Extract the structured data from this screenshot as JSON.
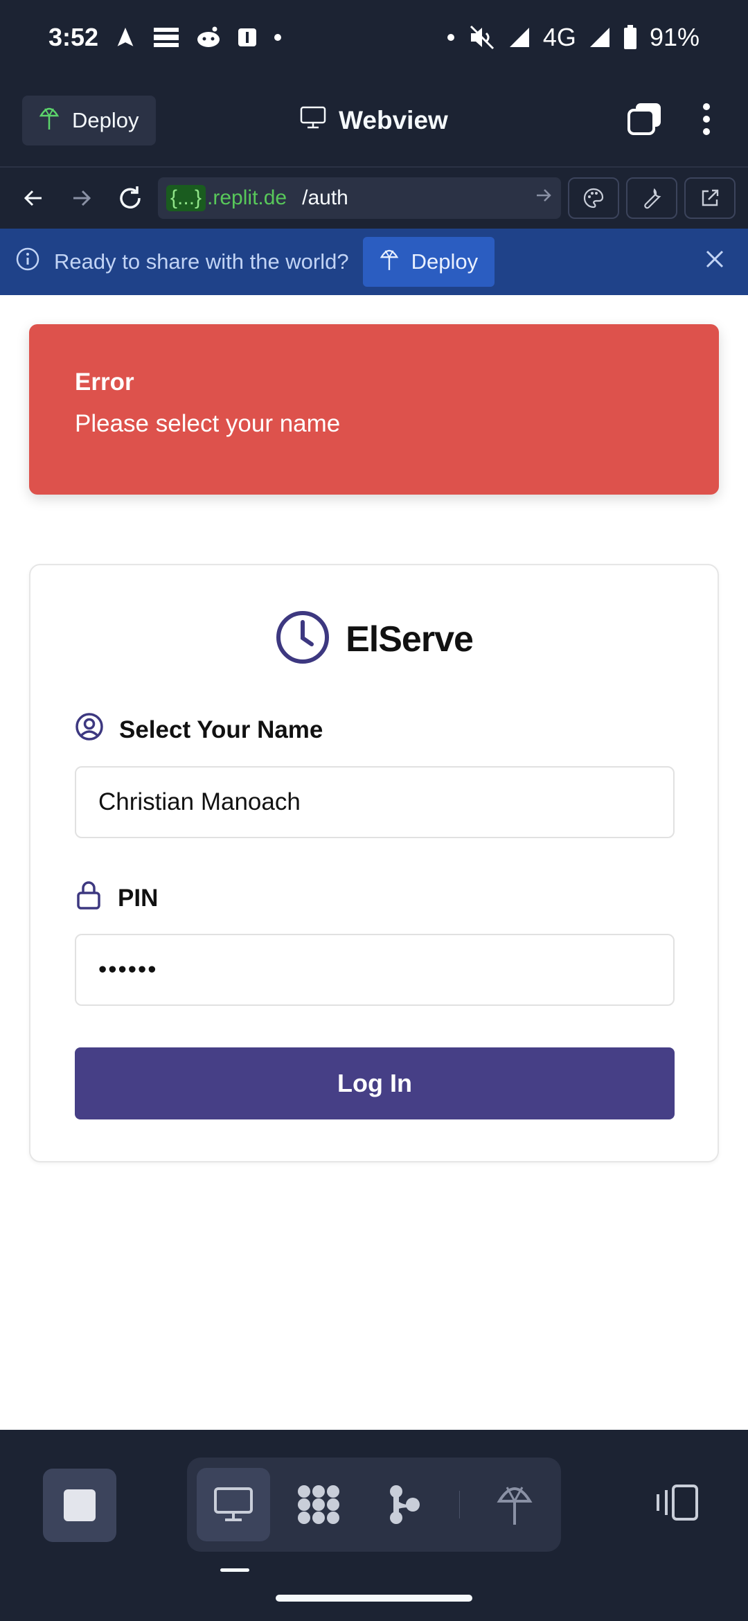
{
  "status_bar": {
    "time": "3:52",
    "network": "4G",
    "battery": "91%"
  },
  "header": {
    "deploy_label": "Deploy",
    "title": "Webview"
  },
  "url_bar": {
    "domain_braces": "{...}",
    "domain": ".replit.de",
    "path": "/auth"
  },
  "banner": {
    "message": "Ready to share with the world?",
    "deploy_label": "Deploy"
  },
  "toast": {
    "title": "Error",
    "message": "Please select your name"
  },
  "login": {
    "brand": "ElServe",
    "name_label": "Select Your Name",
    "name_value": "Christian Manoach",
    "pin_label": "PIN",
    "pin_value": "••••••",
    "submit_label": "Log In"
  },
  "colors": {
    "accent": "#463f86",
    "error": "#dd524c",
    "banner": "#1f4289"
  }
}
